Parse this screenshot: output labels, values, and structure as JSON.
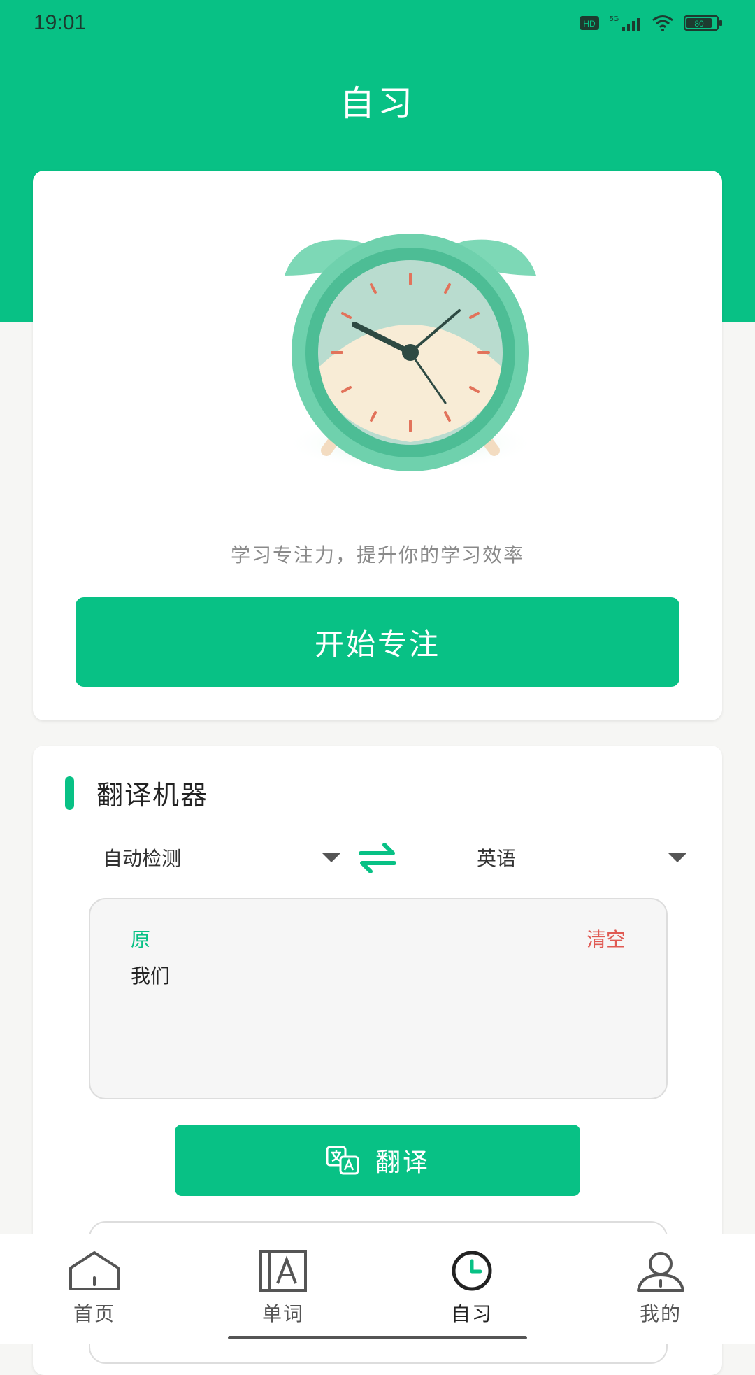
{
  "status_bar": {
    "time": "19:01",
    "icons": [
      "hd-icon",
      "5g-signal-icon",
      "wifi-icon",
      "battery-icon"
    ],
    "battery_text": "80"
  },
  "header": {
    "title": "自习"
  },
  "focus_card": {
    "illustration": "alarm-clock-icon",
    "subtitle": "学习专注力，提升你的学习效率",
    "start_button": "开始专注"
  },
  "translate_card": {
    "title": "翻译机器",
    "source_language": "自动检测",
    "target_language": "英语",
    "swap_icon": "swap-arrows-icon",
    "source_tag": "原",
    "clear_label": "清空",
    "source_text": "我们",
    "translate_button": "翻译",
    "translate_icon": "translate-icon"
  },
  "tabs": [
    {
      "label": "首页",
      "icon": "home-icon",
      "active": false
    },
    {
      "label": "单词",
      "icon": "word-book-icon",
      "active": false
    },
    {
      "label": "自习",
      "icon": "clock-icon",
      "active": true
    },
    {
      "label": "我的",
      "icon": "profile-icon",
      "active": false
    }
  ],
  "colors": {
    "accent": "#08c185",
    "clear_red": "#e05a53",
    "page_bg": "#f6f6f4"
  }
}
